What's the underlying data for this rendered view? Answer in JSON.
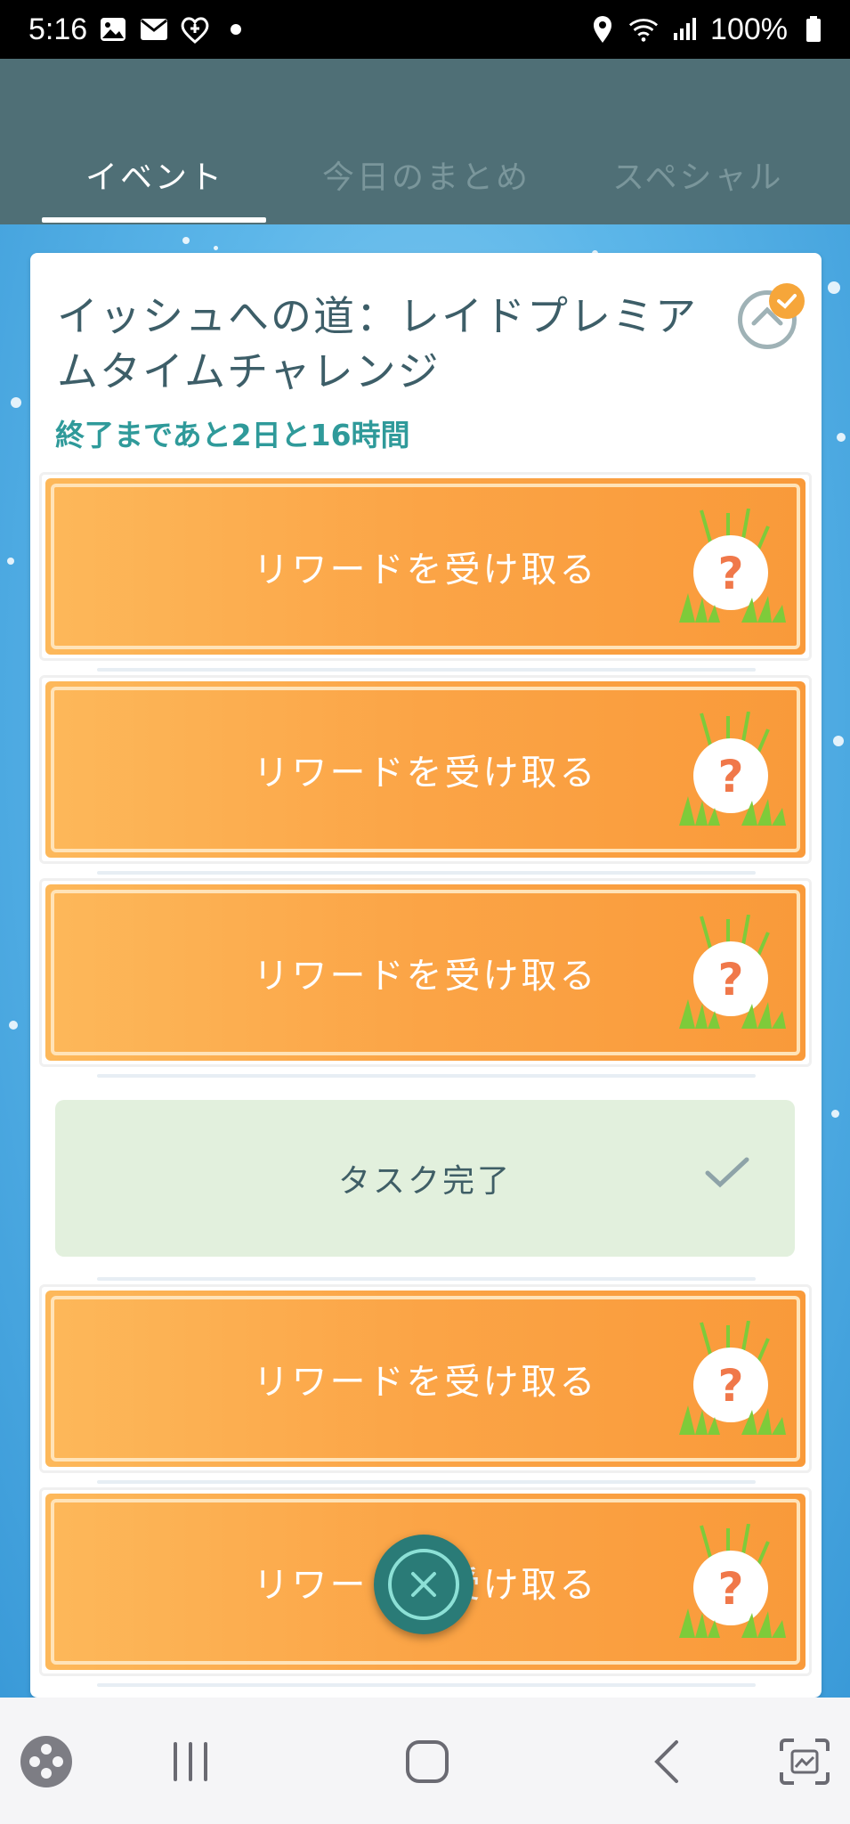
{
  "status_bar": {
    "time": "5:16",
    "battery_text": "100%",
    "left_icons": [
      "image-icon",
      "mail-icon",
      "heart-app-icon",
      "dot-icon"
    ],
    "right_icons": [
      "location-icon",
      "wifi-icon",
      "signal-icon",
      "battery-icon"
    ]
  },
  "header": {
    "tabs": [
      {
        "label": "イベント",
        "active": true
      },
      {
        "label": "今日のまとめ",
        "active": false
      },
      {
        "label": "スペシャル",
        "active": false
      }
    ]
  },
  "card": {
    "title": "イッシュへの道：レイドプレミアムタイムチャレンジ",
    "subtitle": "終了まであと2日と16時間",
    "items": [
      {
        "type": "reward",
        "label": "リワードを受け取る"
      },
      {
        "type": "reward",
        "label": "リワードを受け取る"
      },
      {
        "type": "reward",
        "label": "リワードを受け取る"
      },
      {
        "type": "complete",
        "label": "タスク完了"
      },
      {
        "type": "reward",
        "label": "リワードを受け取る"
      },
      {
        "type": "reward",
        "label": "リワードを受け取る"
      }
    ]
  },
  "colors": {
    "header": "#4f6f76",
    "reward_orange": "#fba446",
    "complete_green": "#e2f0dd",
    "accent_teal": "#2f9a9a"
  },
  "nav_bar": {
    "icons": [
      "game-launcher-icon",
      "recent-apps-icon",
      "home-icon",
      "back-icon",
      "screenshot-icon"
    ]
  }
}
